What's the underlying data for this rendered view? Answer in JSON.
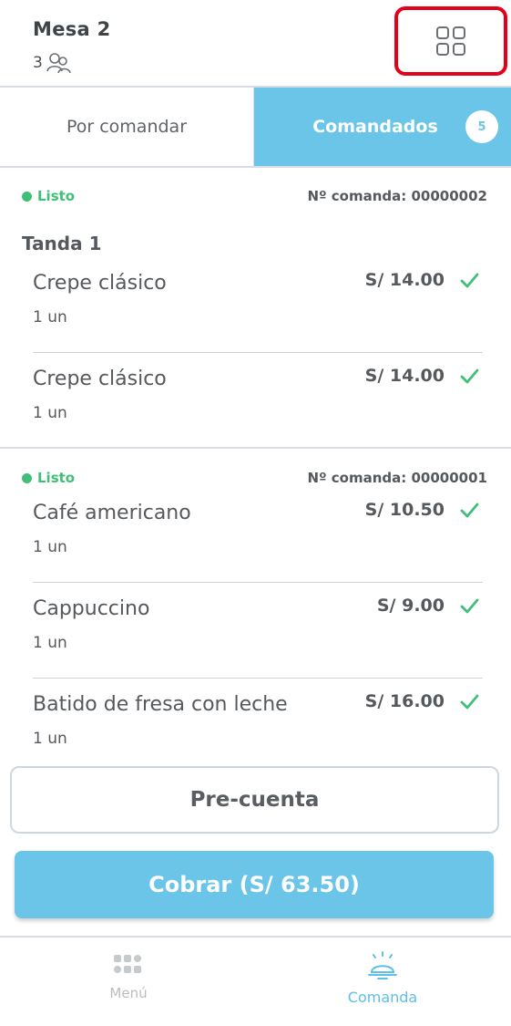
{
  "header": {
    "title": "Mesa  2",
    "guest_count": "3",
    "guest_icon": "people-icon",
    "grid_icon": "grid-icon"
  },
  "tabs": {
    "left_label": "Por comandar",
    "right_label": "Comandados",
    "badge_count": "5"
  },
  "orders": [
    {
      "status": "Listo",
      "order_number": "Nº comanda: 00000002",
      "tanda": "Tanda 1",
      "items": [
        {
          "name": "Crepe clásico",
          "qty": "1 un",
          "price": "S/ 14.00"
        },
        {
          "name": "Crepe clásico",
          "qty": "1 un",
          "price": "S/ 14.00"
        }
      ]
    },
    {
      "status": "Listo",
      "order_number": "Nº comanda: 00000001",
      "items": [
        {
          "name": "Café americano",
          "qty": "1 un",
          "price": "S/ 10.50"
        },
        {
          "name": "Cappuccino",
          "qty": "1 un",
          "price": "S/ 9.00"
        },
        {
          "name": "Batido de fresa con leche",
          "qty": "1 un",
          "price": "S/ 16.00"
        }
      ]
    }
  ],
  "buttons": {
    "precuenta": "Pre-cuenta",
    "cobrar": "Cobrar (S/ 63.50)"
  },
  "bottom_nav": {
    "menu_label": "Menú",
    "comanda_label": "Comanda"
  },
  "colors": {
    "accent": "#6ac5e8",
    "status_ok": "#3fbf77",
    "highlight_border": "#e3001b"
  }
}
